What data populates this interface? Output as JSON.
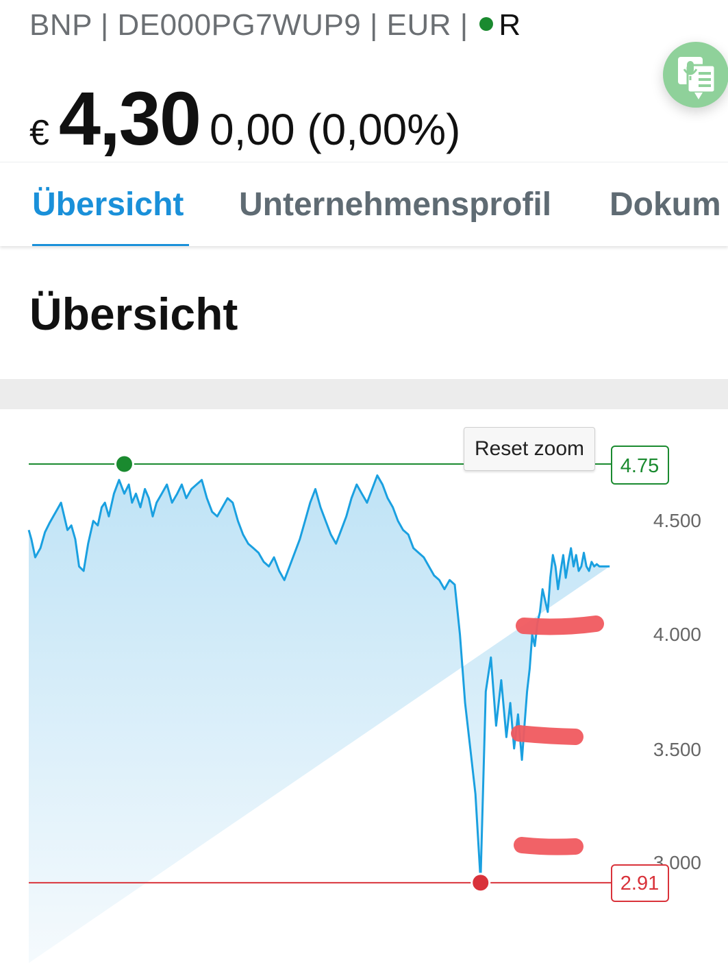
{
  "header": {
    "meta_text": "BNP | DE000PG7WUP9 | EUR |",
    "status_flag": "R",
    "status_color": "#1a8a2f"
  },
  "price": {
    "currency": "€",
    "value": "4,30",
    "change": "0,00 (0,00%)"
  },
  "tabs": [
    {
      "label": "Übersicht",
      "active": true
    },
    {
      "label": "Unternehmensprofil",
      "active": false
    },
    {
      "label": "Dokum",
      "active": false
    }
  ],
  "section": {
    "title": "Übersicht"
  },
  "chart_controls": {
    "reset_zoom_label": "Reset zoom"
  },
  "colors": {
    "accent": "#1a90d9",
    "line": "#1aa0e0",
    "high": "#1a8a2f",
    "low": "#d9323a",
    "annotation": "#f05a5f",
    "fab": "#8fd19a"
  },
  "icons": {
    "fab_icon": "voice-text-icon"
  },
  "chart_data": {
    "type": "area",
    "yticks": [
      "4.500",
      "4.000",
      "3.500",
      "3.000"
    ],
    "ylim": [
      2.6,
      4.85
    ],
    "x": [
      0,
      4,
      10,
      18,
      25,
      32,
      38,
      44,
      50,
      55,
      60,
      66,
      72,
      78,
      85,
      92,
      100,
      107,
      113,
      118,
      124,
      132,
      140,
      148,
      155,
      160,
      166,
      173,
      180,
      186,
      192,
      198,
      206,
      214,
      222,
      230,
      237,
      244,
      252,
      260,
      268,
      276,
      284,
      292,
      300,
      308,
      316,
      324,
      332,
      340,
      348,
      356,
      364,
      372,
      380,
      388,
      396,
      404,
      412,
      420,
      428,
      436,
      444,
      452,
      460,
      468,
      476,
      484,
      492,
      500,
      508,
      516,
      524,
      532,
      540,
      548,
      556,
      564,
      572,
      580,
      588,
      596,
      604,
      612,
      620,
      628,
      636,
      644,
      652,
      660,
      668,
      676,
      684,
      692,
      700,
      708,
      716,
      724,
      732,
      740,
      746,
      752,
      758,
      764,
      768,
      772,
      776,
      780,
      784,
      788,
      792,
      796,
      800,
      804,
      808,
      812,
      816,
      820,
      824,
      828,
      832,
      836,
      840,
      844,
      848,
      852,
      856,
      860,
      864,
      868,
      872,
      876,
      880,
      884,
      888,
      892,
      896,
      900,
      904
    ],
    "y": [
      4.46,
      4.42,
      4.34,
      4.38,
      4.45,
      4.49,
      4.52,
      4.55,
      4.58,
      4.52,
      4.46,
      4.48,
      4.42,
      4.3,
      4.28,
      4.4,
      4.5,
      4.48,
      4.56,
      4.58,
      4.52,
      4.62,
      4.68,
      4.62,
      4.66,
      4.58,
      4.62,
      4.56,
      4.64,
      4.6,
      4.52,
      4.58,
      4.62,
      4.66,
      4.58,
      4.62,
      4.66,
      4.6,
      4.64,
      4.66,
      4.68,
      4.6,
      4.54,
      4.52,
      4.56,
      4.6,
      4.58,
      4.5,
      4.44,
      4.4,
      4.38,
      4.36,
      4.32,
      4.3,
      4.34,
      4.28,
      4.24,
      4.3,
      4.36,
      4.42,
      4.5,
      4.58,
      4.64,
      4.56,
      4.5,
      4.44,
      4.4,
      4.46,
      4.52,
      4.6,
      4.66,
      4.62,
      4.58,
      4.64,
      4.7,
      4.66,
      4.6,
      4.56,
      4.5,
      4.46,
      4.44,
      4.38,
      4.36,
      4.34,
      4.3,
      4.26,
      4.24,
      4.2,
      4.24,
      4.22,
      4.0,
      3.7,
      3.5,
      3.3,
      2.92,
      3.75,
      3.9,
      3.6,
      3.8,
      3.55,
      3.7,
      3.5,
      3.65,
      3.45,
      3.6,
      3.75,
      3.85,
      4.0,
      3.95,
      4.05,
      4.1,
      4.2,
      4.15,
      4.1,
      4.25,
      4.35,
      4.3,
      4.2,
      4.28,
      4.35,
      4.25,
      4.32,
      4.38,
      4.3,
      4.35,
      4.28,
      4.3,
      4.36,
      4.3,
      4.28,
      4.32,
      4.3,
      4.31,
      4.3,
      4.3,
      4.3,
      4.3,
      4.3
    ],
    "high": {
      "label": "4.75",
      "value": 4.75,
      "x_index": 23
    },
    "low": {
      "label": "2.91",
      "value": 2.91,
      "x_index": 94
    },
    "legend": "none",
    "grid": false
  }
}
